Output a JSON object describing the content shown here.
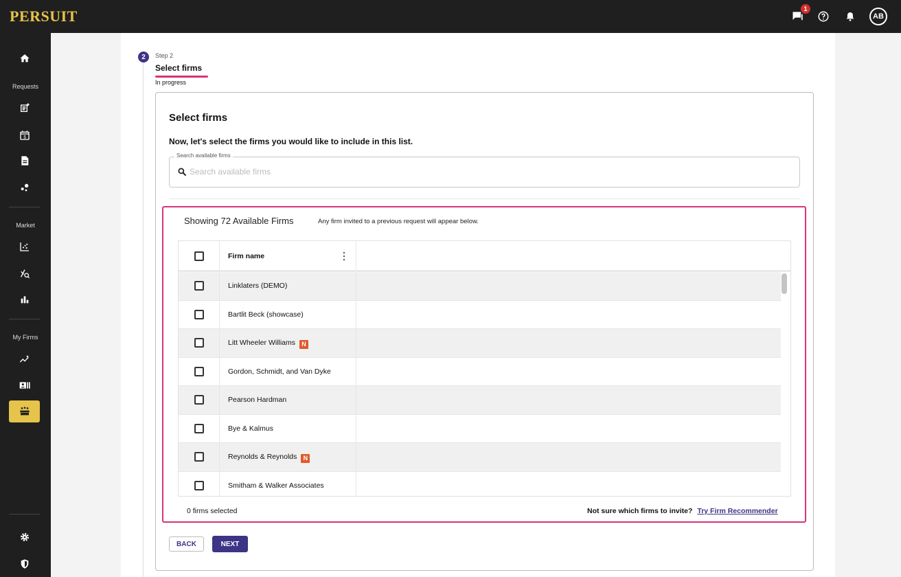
{
  "app": {
    "logo": "PERSUIT"
  },
  "topbar": {
    "message_badge": "1",
    "avatar_initials": "AB"
  },
  "sidebar": {
    "sections": {
      "requests": "Requests",
      "market": "Market",
      "my_firms": "My Firms"
    }
  },
  "step": {
    "number": "2",
    "small_label": "Step 2",
    "title": "Select firms",
    "status": "In progress"
  },
  "card": {
    "title": "Select firms",
    "subtitle": "Now, let's select the firms you would like to include in this list.",
    "search": {
      "legend": "Search available firms",
      "placeholder": "Search available firms",
      "value": ""
    }
  },
  "firms": {
    "showing_title": "Showing 72 Available Firms",
    "note": "Any firm invited to a previous request will appear below.",
    "column_header": "Firm name",
    "new_badge": "N",
    "rows": [
      {
        "name": "Linklaters (DEMO)",
        "is_new": false
      },
      {
        "name": "Bartlit Beck (showcase)",
        "is_new": false
      },
      {
        "name": "Litt Wheeler Williams",
        "is_new": true
      },
      {
        "name": "Gordon, Schmidt, and Van Dyke",
        "is_new": false
      },
      {
        "name": "Pearson Hardman",
        "is_new": false
      },
      {
        "name": "Bye & Kalmus",
        "is_new": false
      },
      {
        "name": "Reynolds & Reynolds",
        "is_new": true
      },
      {
        "name": "Smitham & Walker Associates",
        "is_new": false
      }
    ],
    "selected_count": "0 firms selected",
    "recommender_prompt": "Not sure which firms to invite?",
    "recommender_link": "Try Firm Recommender"
  },
  "actions": {
    "back_label": "BACK",
    "next_label": "NEXT"
  },
  "colors": {
    "brand_gold": "#e6c34a",
    "primary": "#3d3486",
    "highlight": "#d6337a",
    "new_badge": "#e05a2b",
    "chrome": "#1f1f1f"
  }
}
